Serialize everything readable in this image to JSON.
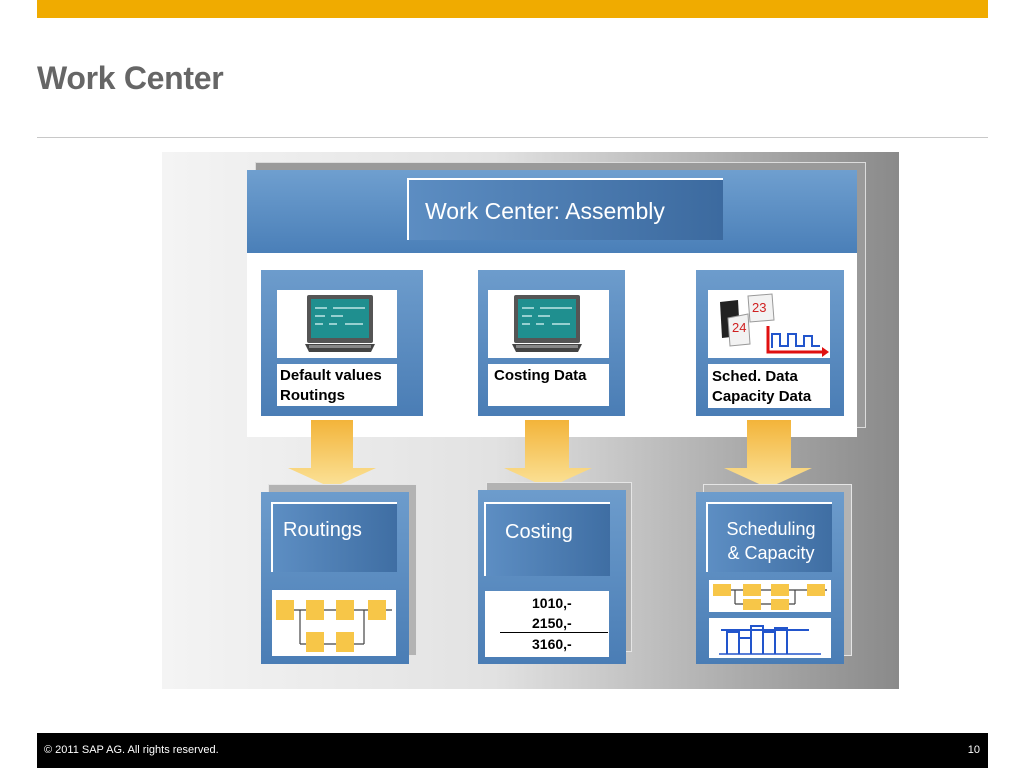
{
  "slide": {
    "title": "Work Center",
    "accent_color": "#f0ab00"
  },
  "diagram": {
    "header_title": "Work Center: Assembly",
    "data_cards": [
      {
        "lines": [
          "Default values",
          "Routings"
        ],
        "icon": "monitor-icon"
      },
      {
        "lines": [
          "Costing Data"
        ],
        "icon": "monitor-icon"
      },
      {
        "lines": [
          "Sched. Data",
          "Capacity  Data"
        ],
        "icon": "calendar-chart-icon",
        "calendar_numbers": [
          "23",
          "24"
        ]
      }
    ],
    "targets": [
      {
        "title": "Routings",
        "icon": "routing-network-icon"
      },
      {
        "title": "Costing",
        "values": [
          "1010,-",
          "2150,-",
          "3160,-"
        ]
      },
      {
        "title_lines": [
          "Scheduling",
          "& Capacity"
        ],
        "icons": [
          "routing-network-icon",
          "capacity-chart-icon"
        ]
      }
    ],
    "arrow_color": "#f7c648"
  },
  "footer": {
    "copyright": "©  2011 SAP AG. All rights reserved.",
    "page_number": "10"
  }
}
